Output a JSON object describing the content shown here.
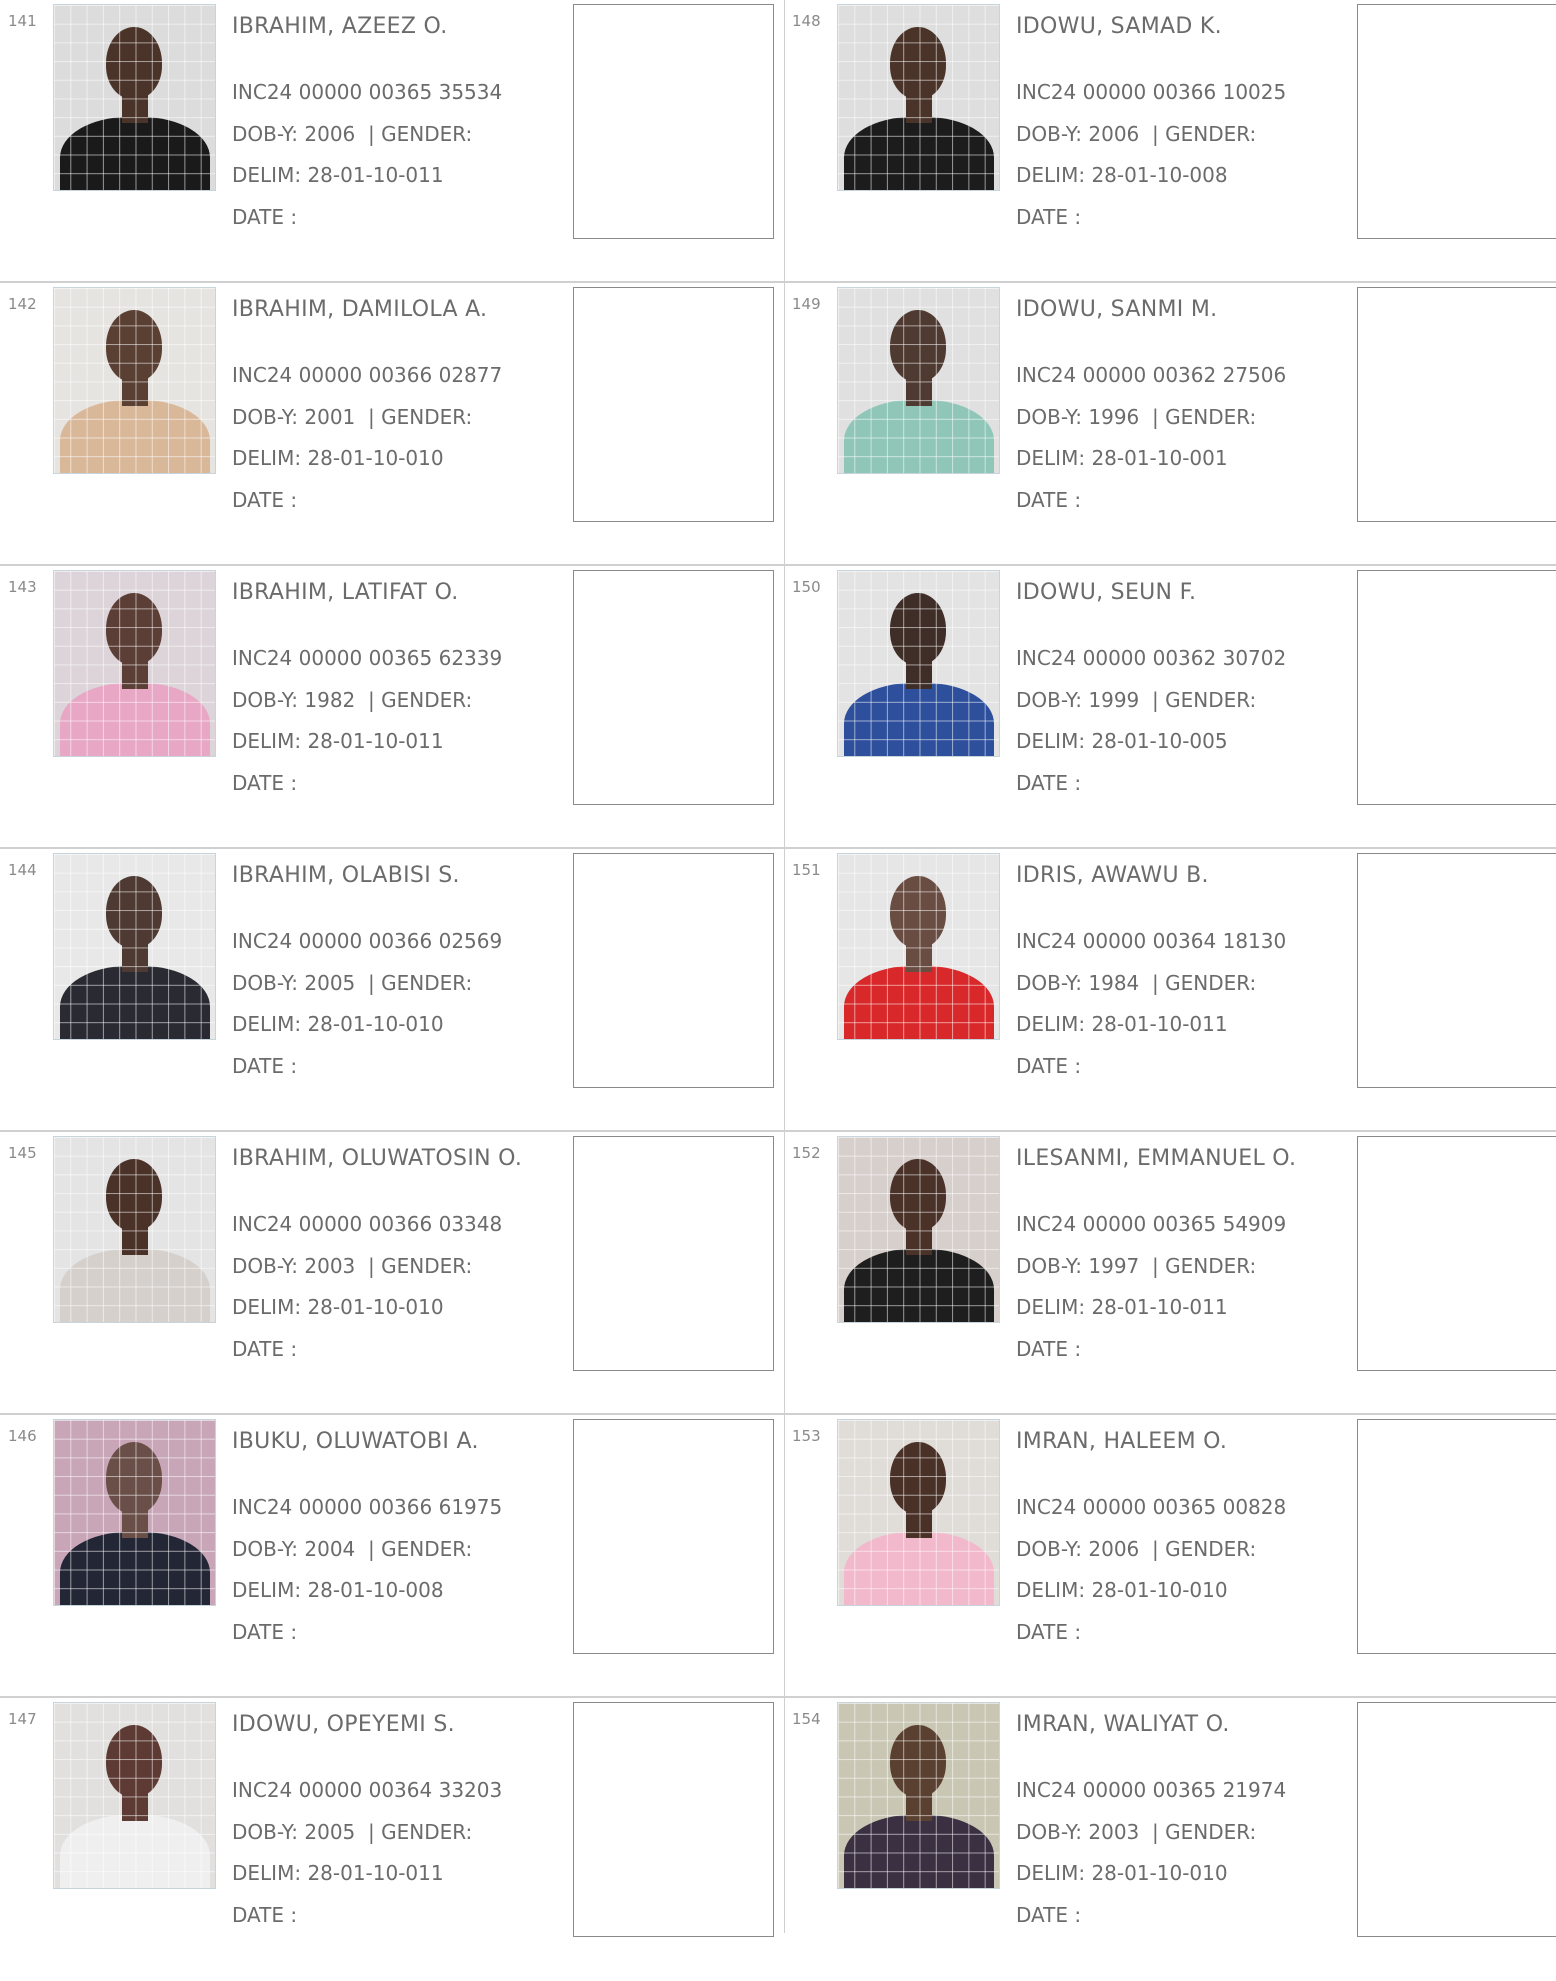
{
  "labels": {
    "dob": "DOB-Y:",
    "gender": "| GENDER:",
    "delim": "DELIM:",
    "date": "DATE  :"
  },
  "records": [
    {
      "num": "141",
      "name": "IBRAHIM, AZEEZ O.",
      "id": "INC24 00000 00365 35534",
      "dob": "2006",
      "delim": "28-01-10-011",
      "photo": {
        "wall": "#dcdcdc",
        "skin": "#4a3328",
        "shirt": "#1a1a1a"
      }
    },
    {
      "num": "142",
      "name": "IBRAHIM, DAMILOLA A.",
      "id": "INC24 00000 00366 02877",
      "dob": "2001",
      "delim": "28-01-10-010",
      "photo": {
        "wall": "#e6e4e0",
        "skin": "#5a3f33",
        "shirt": "#d9b89a"
      }
    },
    {
      "num": "143",
      "name": "IBRAHIM, LATIFAT O.",
      "id": "INC24 00000 00365 62339",
      "dob": "1982",
      "delim": "28-01-10-011",
      "photo": {
        "wall": "#dcd4d8",
        "skin": "#5b3e35",
        "shirt": "#e7a7c5"
      }
    },
    {
      "num": "144",
      "name": "IBRAHIM, OLABISI S.",
      "id": "INC24 00000 00366 02569",
      "dob": "2005",
      "delim": "28-01-10-010",
      "photo": {
        "wall": "#e8e8e8",
        "skin": "#4e3a32",
        "shirt": "#2a2a33"
      }
    },
    {
      "num": "145",
      "name": "IBRAHIM, OLUWATOSIN O.",
      "id": "INC24 00000 00366 03348",
      "dob": "2003",
      "delim": "28-01-10-010",
      "photo": {
        "wall": "#e4e4e4",
        "skin": "#4b3229",
        "shirt": "#d5d0cc"
      }
    },
    {
      "num": "146",
      "name": "IBUKU, OLUWATOBI A.",
      "id": "INC24 00000 00366 61975",
      "dob": "2004",
      "delim": "28-01-10-008",
      "photo": {
        "wall": "#c8a6b8",
        "skin": "#6a4e48",
        "shirt": "#232635"
      }
    },
    {
      "num": "147",
      "name": "IDOWU, OPEYEMI S.",
      "id": "INC24 00000 00364 33203",
      "dob": "2005",
      "delim": "28-01-10-011",
      "photo": {
        "wall": "#e2e0df",
        "skin": "#5d3a34",
        "shirt": "#efefef"
      }
    },
    {
      "num": "148",
      "name": "IDOWU, SAMAD K.",
      "id": "INC24 00000 00366 10025",
      "dob": "2006",
      "delim": "28-01-10-008",
      "photo": {
        "wall": "#dedede",
        "skin": "#4a3429",
        "shirt": "#1c1c1c"
      }
    },
    {
      "num": "149",
      "name": "IDOWU, SANMI M.",
      "id": "INC24 00000 00362 27506",
      "dob": "1996",
      "delim": "28-01-10-001",
      "photo": {
        "wall": "#e0e0e0",
        "skin": "#4e3a31",
        "shirt": "#8fc6b8"
      }
    },
    {
      "num": "150",
      "name": "IDOWU, SEUN F.",
      "id": "INC24 00000 00362 30702",
      "dob": "1999",
      "delim": "28-01-10-005",
      "photo": {
        "wall": "#e3e3e3",
        "skin": "#3f2e27",
        "shirt": "#2e4f9c"
      }
    },
    {
      "num": "151",
      "name": "IDRIS, AWAWU B.",
      "id": "INC24 00000 00364 18130",
      "dob": "1984",
      "delim": "28-01-10-011",
      "photo": {
        "wall": "#e6e6e6",
        "skin": "#6a4d42",
        "shirt": "#d8282a"
      }
    },
    {
      "num": "152",
      "name": "ILESANMI, EMMANUEL O.",
      "id": "INC24 00000 00365 54909",
      "dob": "1997",
      "delim": "28-01-10-011",
      "photo": {
        "wall": "#d6cfcc",
        "skin": "#4a3229",
        "shirt": "#1e1e1e"
      }
    },
    {
      "num": "153",
      "name": "IMRAN, HALEEM O.",
      "id": "INC24 00000 00365 00828",
      "dob": "2006",
      "delim": "28-01-10-010",
      "photo": {
        "wall": "#e0dcd8",
        "skin": "#4a3127",
        "shirt": "#f2b8cc"
      }
    },
    {
      "num": "154",
      "name": "IMRAN, WALIYAT O.",
      "id": "INC24 00000 00365 21974",
      "dob": "2003",
      "delim": "28-01-10-010",
      "photo": {
        "wall": "#c9c6b4",
        "skin": "#5a4030",
        "shirt": "#3a3042"
      }
    }
  ]
}
